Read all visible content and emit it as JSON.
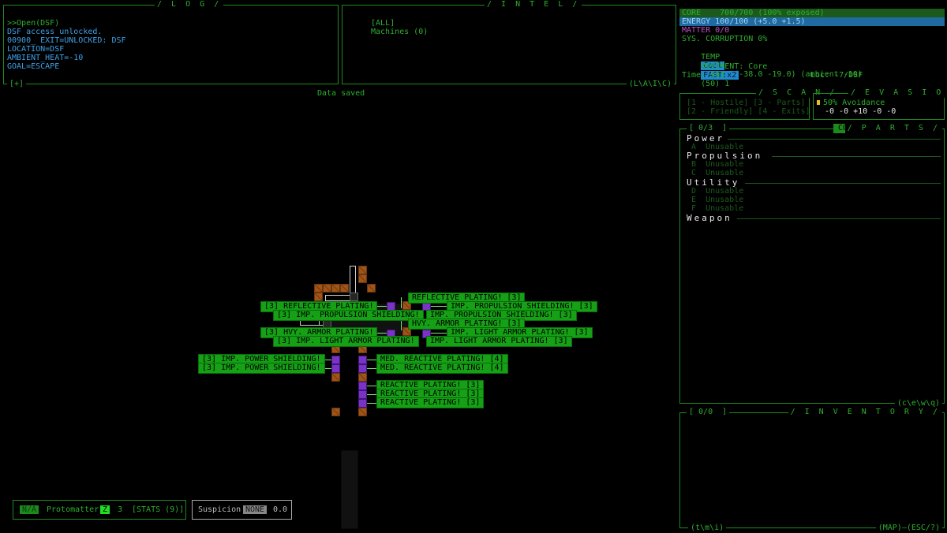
{
  "log": {
    "title": "/ L O G /",
    "lines": [
      ">>Open(DSF)",
      "DSF access unlocked.",
      "00900_ EXIT=UNLOCKED: DSF",
      "LOCATION=DSF",
      "AMBIENT_HEAT=-10",
      "GOAL=ESCAPE"
    ],
    "footer": "[+]"
  },
  "intel": {
    "title": "/ I N T E L /",
    "lines": [
      "[ALL]",
      "Machines (0)"
    ],
    "footer": "(L\\A\\I\\C)"
  },
  "message": "Data saved",
  "status": {
    "core": "CORE    700/700 (100% exposed)",
    "energy": "ENERGY 100/100 (+5.0 +1.5)",
    "matter": "MATTER 0/0",
    "corruption": "SYS. CORRUPTION 0%",
    "temp_label": "TEMP",
    "temp_value": "Cool",
    "temp_rest": "Heat 0 (-38.0 -19.0) (ambient -10)",
    "movement_label": "MOVEMENT: Core",
    "movement_value": "FAST:x2",
    "movement_rest": "(50) 1",
    "time": "Time: 901",
    "loc": "Loc: -7/DSF"
  },
  "scan": {
    "title": "/ S C A N /",
    "row1": "[1 - Hostile] [3 - Parts]",
    "row2": "[2 - Friendly] [4 - Exits]"
  },
  "evasion": {
    "title": "/ E V A S I O N /",
    "avoidance": "50% Avoidance",
    "mods": "-0 -0 +10 -0 -0"
  },
  "parts": {
    "title": "/ P A R T S /",
    "count": "[ 0/3  ]",
    "badge": "COGMIND",
    "footer": "(c\\e\\w\\q)",
    "sections": [
      {
        "name": "Power",
        "slots": [
          {
            "key": "A",
            "label": "Unusable"
          }
        ]
      },
      {
        "name": "Propulsion",
        "slots": [
          {
            "key": "B",
            "label": "Unusable"
          },
          {
            "key": "C",
            "label": "Unusable"
          }
        ]
      },
      {
        "name": "Utility",
        "slots": [
          {
            "key": "D",
            "label": "Unusable"
          },
          {
            "key": "E",
            "label": "Unusable"
          },
          {
            "key": "F",
            "label": "Unusable"
          }
        ]
      },
      {
        "name": "Weapon",
        "slots": []
      }
    ]
  },
  "inventory": {
    "title": "/ I N V E N T O R Y /",
    "count": "[ 0/0  ]",
    "footer_left": "(t\\m\\i)",
    "footer_right": "(MAP)—(ESC/?)"
  },
  "map_labels": [
    "REFLECTIVE PLATING! [3]",
    "[3] REFLECTIVE PLATING!",
    "IMP. PROPULSION SHIELDING! [3]",
    "[3] IMP. PROPULSION SHIELDING!",
    "IMP. PROPULSION SHIELDING! [3]",
    "HVY. ARMOR PLATING! [3]",
    "[3] HVY. ARMOR PLATING!",
    "IMP. LIGHT ARMOR PLATING! [3]",
    "[3] IMP. LIGHT ARMOR PLATING!",
    "IMP. LIGHT ARMOR PLATING! [3]",
    "[3] IMP. POWER SHIELDING!",
    "[3] IMP. POWER SHIELDING!",
    "MED. REACTIVE PLATING! [4]",
    "MED. REACTIVE PLATING! [4]",
    "REACTIVE PLATING! [3]",
    "REACTIVE PLATING! [3]",
    "REACTIVE PLATING! [3]"
  ],
  "bottom": {
    "na": "N/A",
    "protomatter": "Protomatter",
    "pm_badge": "Z",
    "pm_count": "3",
    "stats": "[STATS (9)]",
    "suspicion": "Suspicion",
    "susp_badge": "NONE",
    "susp_value": "0.0"
  },
  "colors": {
    "panel": "#1f8a1f",
    "text": "#2fae2f",
    "log_text": "#3fa0e8",
    "core_bar": "#1c5a1c",
    "energy_bar": "#1f6aa0",
    "label_bg": "#15a015",
    "item": "#7a32c8",
    "wall": "#a05418",
    "matter": "#c04ec8"
  }
}
